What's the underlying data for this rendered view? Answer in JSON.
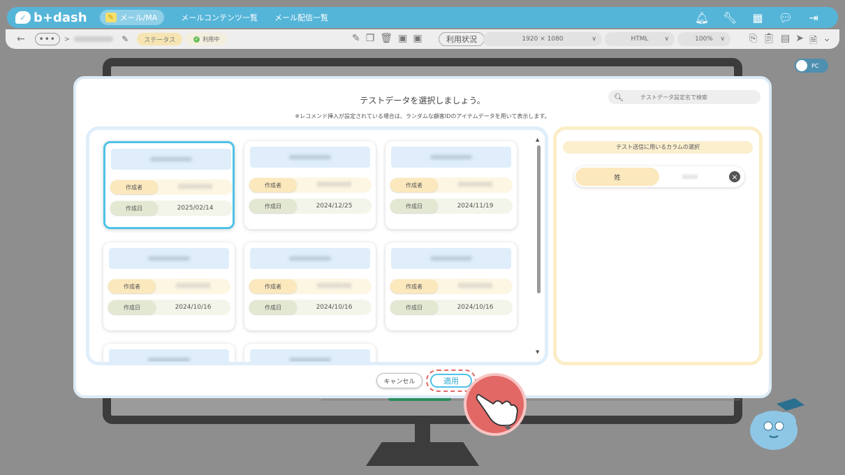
{
  "header": {
    "logo_text": "b+dash",
    "mail_ma_label": "メール/MA",
    "nav": [
      "メールコンテンツ一覧",
      "メール配信一覧"
    ],
    "icons": [
      "bell-icon",
      "wrench-icon",
      "grid-icon",
      "chat-icon",
      "logout-icon"
    ]
  },
  "toolbar": {
    "back": "←",
    "dots": "•••",
    "breadcrumb_sep": ">",
    "status_label": "ステータス",
    "in_use_label": "利用中",
    "usage_label": "利用状況",
    "resolution": "1920 × 1080",
    "format": "HTML",
    "zoom": "100%",
    "chevron": "∨"
  },
  "background": {
    "toggle_label": "PC"
  },
  "modal": {
    "title": "テストデータを選択しましょう。",
    "note": "※レコメンド挿入が設定されている場合は、ランダムな顧客IDのアイテムデータを用いて表示します。",
    "search_placeholder": "テストデータ設定名で検索",
    "creator_label": "作成者",
    "date_label": "作成日",
    "cards": [
      {
        "date": "2025/02/14",
        "selected": true
      },
      {
        "date": "2024/12/25",
        "selected": false
      },
      {
        "date": "2024/11/19",
        "selected": false
      },
      {
        "date": "2024/10/16",
        "selected": false
      },
      {
        "date": "2024/10/16",
        "selected": false
      },
      {
        "date": "2024/10/16",
        "selected": false
      },
      {
        "date": "",
        "selected": false
      },
      {
        "date": "",
        "selected": false
      }
    ],
    "column_panel_title": "テスト送信に用いるカラムの選択",
    "column": {
      "name": "姓"
    },
    "cancel_label": "キャンセル",
    "apply_label": "適用"
  },
  "colors": {
    "brand": "#55b5d9",
    "selected_border": "#4fc3e8",
    "highlight": "#e26866"
  }
}
